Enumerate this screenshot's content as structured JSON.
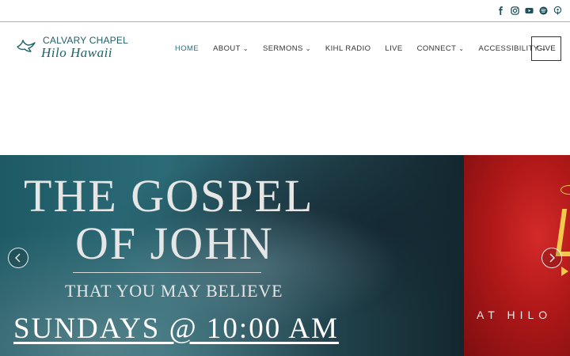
{
  "social": {
    "icons": [
      "facebook-icon",
      "instagram-icon",
      "youtube-icon",
      "spotify-icon",
      "podcast-icon"
    ],
    "color": "#1f4f5a"
  },
  "logo": {
    "line1": "CALVARY CHAPEL",
    "line2": "Hilo Hawaii",
    "color": "#1f5f6a"
  },
  "nav": {
    "items": [
      {
        "label": "HOME",
        "active": true,
        "dropdown": false
      },
      {
        "label": "ABOUT",
        "active": false,
        "dropdown": true
      },
      {
        "label": "SERMONS",
        "active": false,
        "dropdown": true
      },
      {
        "label": "KIHL RADIO",
        "active": false,
        "dropdown": false
      },
      {
        "label": "LIVE",
        "active": false,
        "dropdown": false
      },
      {
        "label": "CONNECT",
        "active": false,
        "dropdown": true
      },
      {
        "label": "ACCESSIBILITY",
        "active": false,
        "dropdown": true
      }
    ],
    "give_label": "GIVE",
    "active_color": "#2d6d7a"
  },
  "hero": {
    "slide1": {
      "title_line1": "THE GOSPEL",
      "title_line2": "OF JOHN",
      "subtitle": "THAT YOU MAY BELIEVE",
      "schedule": "SUNDAYS @ 10:00 AM",
      "accent_color": "#1d5a66"
    },
    "slide2": {
      "caption": "AT HILO",
      "accent_color": "#c41f1f"
    },
    "prev_icon": "chevron-left-icon",
    "next_icon": "chevron-right-icon"
  }
}
